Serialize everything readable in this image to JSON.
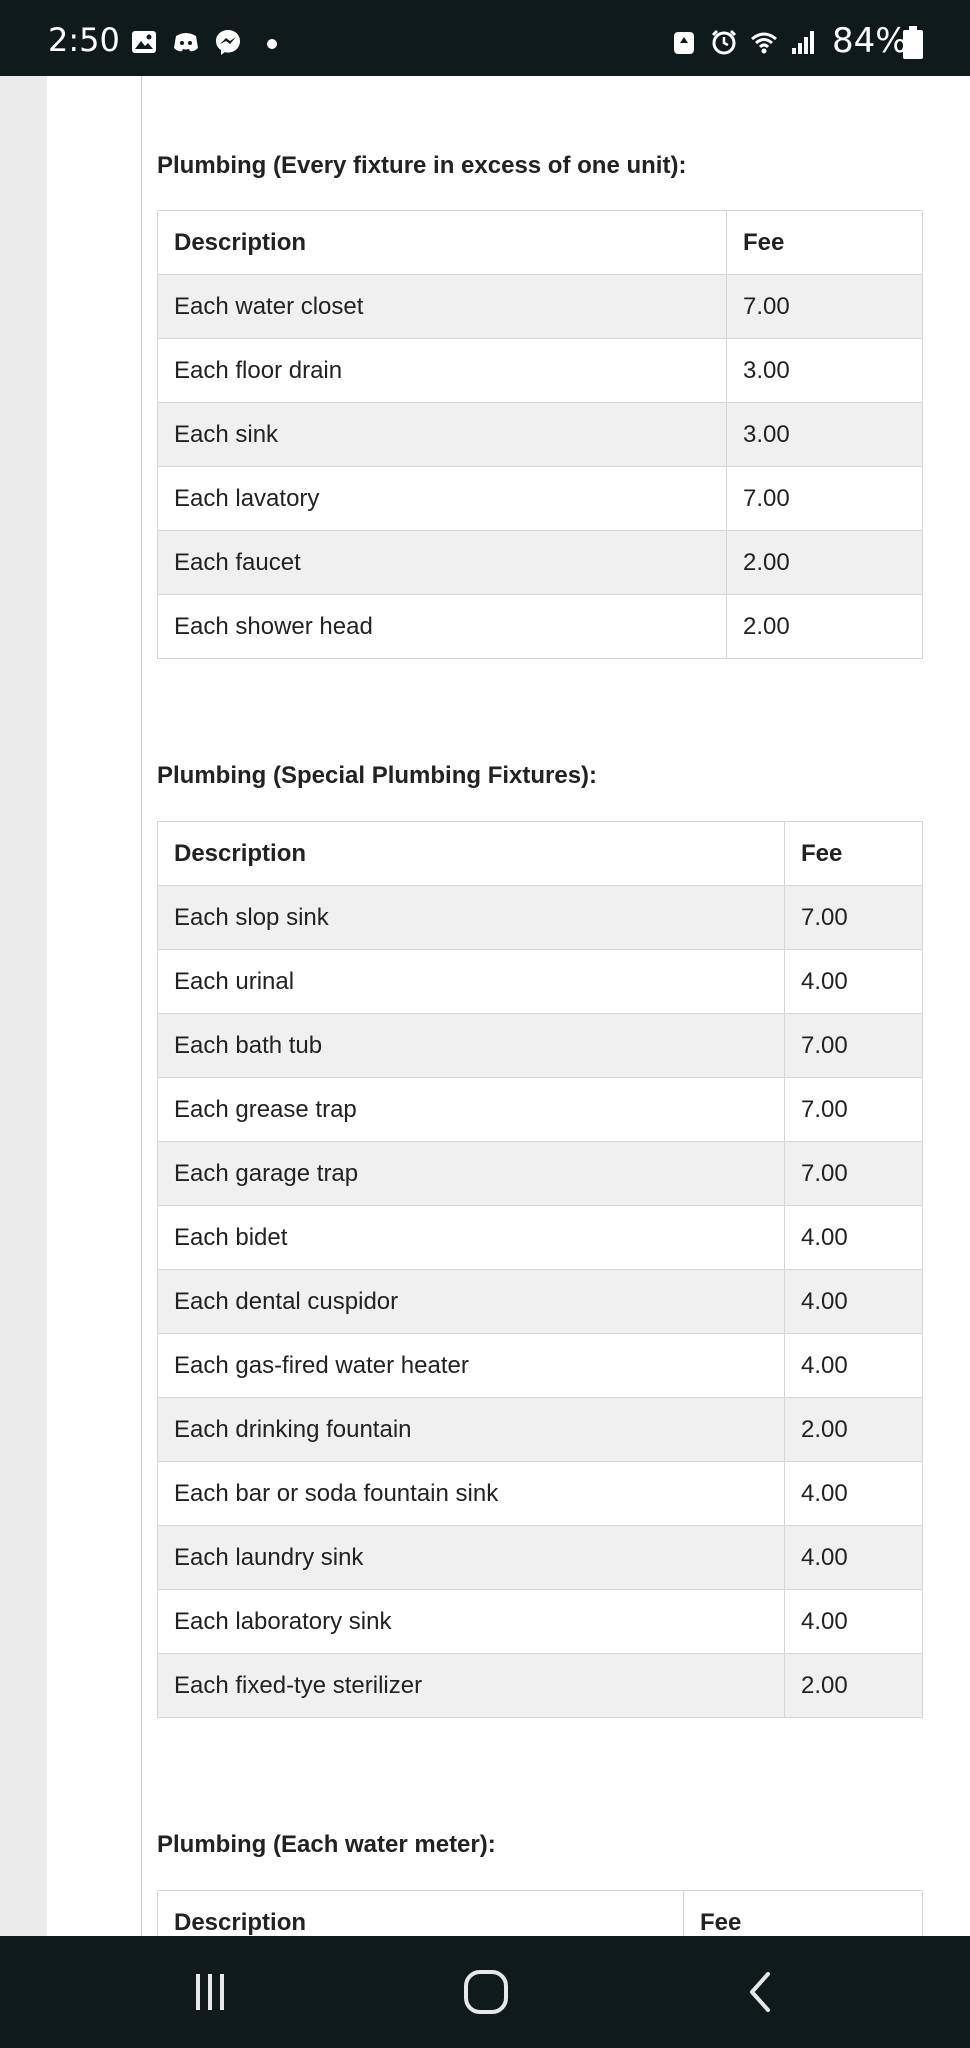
{
  "status_bar": {
    "time": "2:50",
    "battery": "84%",
    "icons": [
      "gallery-icon",
      "discord-icon",
      "messenger-icon",
      "dot-icon",
      "battery-saver-icon",
      "alarm-icon",
      "wifi-icon",
      "signal-icon",
      "battery-icon"
    ]
  },
  "sections": [
    {
      "title": "Plumbing (Every fixture in excess of one unit):",
      "headers": {
        "description": "Description",
        "fee": "Fee"
      },
      "rows": [
        {
          "description": "Each water closet",
          "fee": "7.00"
        },
        {
          "description": "Each floor drain",
          "fee": "3.00"
        },
        {
          "description": "Each sink",
          "fee": "3.00"
        },
        {
          "description": "Each lavatory",
          "fee": "7.00"
        },
        {
          "description": "Each faucet",
          "fee": "2.00"
        },
        {
          "description": "Each shower head",
          "fee": "2.00"
        }
      ]
    },
    {
      "title": "Plumbing (Special Plumbing Fixtures):",
      "headers": {
        "description": "Description",
        "fee": "Fee"
      },
      "rows": [
        {
          "description": "Each slop sink",
          "fee": "7.00"
        },
        {
          "description": "Each urinal",
          "fee": "4.00"
        },
        {
          "description": "Each bath tub",
          "fee": "7.00"
        },
        {
          "description": "Each grease trap",
          "fee": "7.00"
        },
        {
          "description": "Each garage trap",
          "fee": "7.00"
        },
        {
          "description": "Each bidet",
          "fee": "4.00"
        },
        {
          "description": "Each dental cuspidor",
          "fee": "4.00"
        },
        {
          "description": "Each gas-fired water heater",
          "fee": "4.00"
        },
        {
          "description": "Each drinking fountain",
          "fee": "2.00"
        },
        {
          "description": "Each bar or soda fountain sink",
          "fee": "4.00"
        },
        {
          "description": "Each laundry sink",
          "fee": "4.00"
        },
        {
          "description": "Each laboratory sink",
          "fee": "4.00"
        },
        {
          "description": "Each fixed-tye sterilizer",
          "fee": "2.00"
        }
      ]
    },
    {
      "title": "Plumbing (Each water meter):",
      "headers": {
        "description": "Description",
        "fee": "Fee"
      },
      "rows": []
    }
  ],
  "nav_bar": {
    "buttons": [
      "recent-apps-icon",
      "home-icon",
      "back-icon"
    ]
  }
}
